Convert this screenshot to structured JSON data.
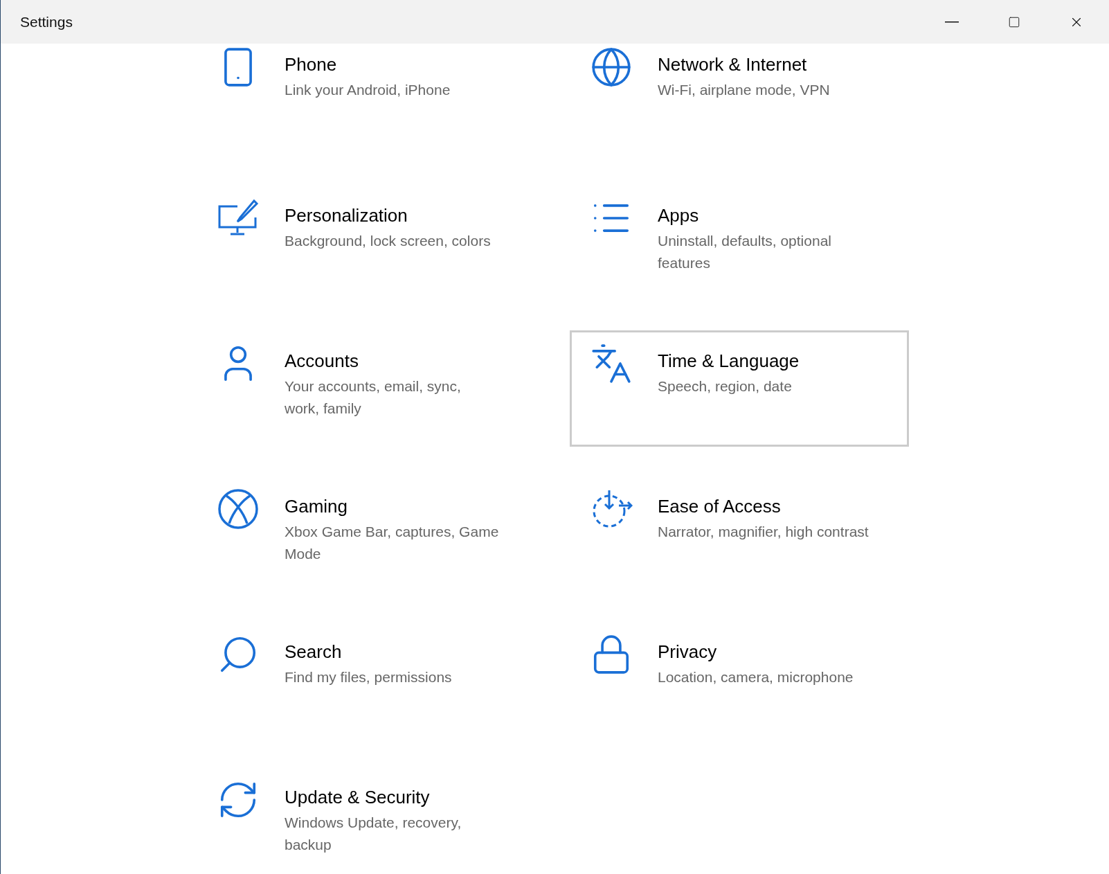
{
  "window": {
    "title": "Settings",
    "controls": [
      {
        "kind": "minimize"
      },
      {
        "kind": "maximize"
      },
      {
        "kind": "close"
      }
    ]
  },
  "categories": [
    {
      "kind": "phone",
      "title": "Phone",
      "subtitle": "Link your Android, iPhone",
      "selected": false
    },
    {
      "kind": "network",
      "title": "Network & Internet",
      "subtitle": "Wi-Fi, airplane mode, VPN",
      "selected": false
    },
    {
      "kind": "personalization",
      "title": "Personalization",
      "subtitle": "Background, lock screen, colors",
      "selected": false
    },
    {
      "kind": "apps",
      "title": "Apps",
      "subtitle": "Uninstall, defaults, optional features",
      "selected": false
    },
    {
      "kind": "accounts",
      "title": "Accounts",
      "subtitle": "Your accounts, email, sync, work, family",
      "selected": false
    },
    {
      "kind": "time",
      "title": "Time & Language",
      "subtitle": "Speech, region, date",
      "selected": true
    },
    {
      "kind": "gaming",
      "title": "Gaming",
      "subtitle": "Xbox Game Bar, captures, Game Mode",
      "selected": false
    },
    {
      "kind": "ease",
      "title": "Ease of Access",
      "subtitle": "Narrator, magnifier, high contrast",
      "selected": false
    },
    {
      "kind": "search",
      "title": "Search",
      "subtitle": "Find my files, permissions",
      "selected": false
    },
    {
      "kind": "privacy",
      "title": "Privacy",
      "subtitle": "Location, camera, microphone",
      "selected": false
    },
    {
      "kind": "update",
      "title": "Update & Security",
      "subtitle": "Windows Update, recovery, backup",
      "selected": false
    }
  ]
}
